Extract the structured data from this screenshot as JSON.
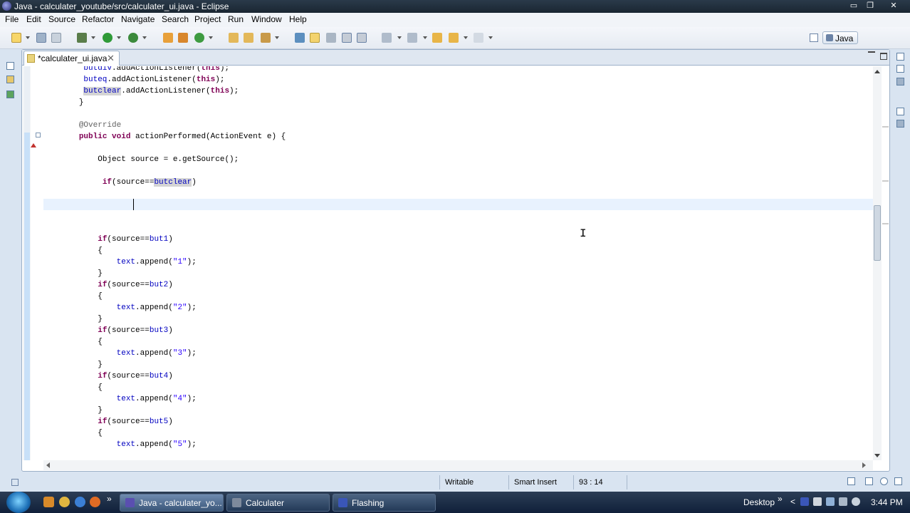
{
  "window": {
    "title": "Java - calculater_youtube/src/calculater_ui.java - Eclipse",
    "min_glyph": "▭",
    "restore_glyph": "❐",
    "close_glyph": "✕"
  },
  "menu": [
    "File",
    "Edit",
    "Source",
    "Refactor",
    "Navigate",
    "Search",
    "Project",
    "Run",
    "Window",
    "Help"
  ],
  "perspective": {
    "label": "Java"
  },
  "editor": {
    "tab_label": "*calculater_ui.java",
    "tab_close": "✕",
    "code_lines": [
      {
        "indent": "    ",
        "parts": [
          {
            "t": "butdiv",
            "c": "fld"
          },
          {
            "t": ".addActionListener("
          },
          {
            "t": "this",
            "c": "kw"
          },
          {
            "t": ");"
          }
        ]
      },
      {
        "indent": "    ",
        "parts": [
          {
            "t": "buteq",
            "c": "fld"
          },
          {
            "t": ".addActionListener("
          },
          {
            "t": "this",
            "c": "kw"
          },
          {
            "t": ");"
          }
        ]
      },
      {
        "indent": "    ",
        "parts": [
          {
            "t": "butclear",
            "c": "fld occ"
          },
          {
            "t": ".addActionListener("
          },
          {
            "t": "this",
            "c": "kw"
          },
          {
            "t": ");"
          }
        ]
      },
      {
        "indent": "   ",
        "parts": [
          {
            "t": "}"
          }
        ]
      },
      {
        "indent": "",
        "parts": []
      },
      {
        "indent": "   ",
        "parts": [
          {
            "t": "@Override",
            "c": "ann"
          }
        ]
      },
      {
        "indent": "   ",
        "parts": [
          {
            "t": "public",
            "c": "kw"
          },
          {
            "t": " "
          },
          {
            "t": "void",
            "c": "kw"
          },
          {
            "t": " actionPerformed(ActionEvent e) {"
          }
        ]
      },
      {
        "indent": "",
        "parts": []
      },
      {
        "indent": "       ",
        "parts": [
          {
            "t": "Object source = e.getSource();"
          }
        ]
      },
      {
        "indent": "",
        "parts": []
      },
      {
        "indent": "        ",
        "parts": [
          {
            "t": "if",
            "c": "kw"
          },
          {
            "t": "(source=="
          },
          {
            "t": "butclear",
            "c": "fld occ"
          },
          {
            "t": ")"
          }
        ]
      },
      {
        "indent": "",
        "parts": []
      },
      {
        "indent": "",
        "parts": []
      },
      {
        "indent": "",
        "parts": []
      },
      {
        "indent": "",
        "parts": []
      },
      {
        "indent": "       ",
        "parts": [
          {
            "t": "if",
            "c": "kw"
          },
          {
            "t": "(source=="
          },
          {
            "t": "but1",
            "c": "fld"
          },
          {
            "t": ")"
          }
        ]
      },
      {
        "indent": "       ",
        "parts": [
          {
            "t": "{"
          }
        ]
      },
      {
        "indent": "           ",
        "parts": [
          {
            "t": "text",
            "c": "fld"
          },
          {
            "t": ".append("
          },
          {
            "t": "\"1\"",
            "c": "str"
          },
          {
            "t": ");"
          }
        ]
      },
      {
        "indent": "       ",
        "parts": [
          {
            "t": "}"
          }
        ]
      },
      {
        "indent": "       ",
        "parts": [
          {
            "t": "if",
            "c": "kw"
          },
          {
            "t": "(source=="
          },
          {
            "t": "but2",
            "c": "fld"
          },
          {
            "t": ")"
          }
        ]
      },
      {
        "indent": "       ",
        "parts": [
          {
            "t": "{"
          }
        ]
      },
      {
        "indent": "           ",
        "parts": [
          {
            "t": "text",
            "c": "fld"
          },
          {
            "t": ".append("
          },
          {
            "t": "\"2\"",
            "c": "str"
          },
          {
            "t": ");"
          }
        ]
      },
      {
        "indent": "       ",
        "parts": [
          {
            "t": "}"
          }
        ]
      },
      {
        "indent": "       ",
        "parts": [
          {
            "t": "if",
            "c": "kw"
          },
          {
            "t": "(source=="
          },
          {
            "t": "but3",
            "c": "fld"
          },
          {
            "t": ")"
          }
        ]
      },
      {
        "indent": "       ",
        "parts": [
          {
            "t": "{"
          }
        ]
      },
      {
        "indent": "           ",
        "parts": [
          {
            "t": "text",
            "c": "fld"
          },
          {
            "t": ".append("
          },
          {
            "t": "\"3\"",
            "c": "str"
          },
          {
            "t": ");"
          }
        ]
      },
      {
        "indent": "       ",
        "parts": [
          {
            "t": "}"
          }
        ]
      },
      {
        "indent": "       ",
        "parts": [
          {
            "t": "if",
            "c": "kw"
          },
          {
            "t": "(source=="
          },
          {
            "t": "but4",
            "c": "fld"
          },
          {
            "t": ")"
          }
        ]
      },
      {
        "indent": "       ",
        "parts": [
          {
            "t": "{"
          }
        ]
      },
      {
        "indent": "           ",
        "parts": [
          {
            "t": "text",
            "c": "fld"
          },
          {
            "t": ".append("
          },
          {
            "t": "\"4\"",
            "c": "str"
          },
          {
            "t": ");"
          }
        ]
      },
      {
        "indent": "       ",
        "parts": [
          {
            "t": "}"
          }
        ]
      },
      {
        "indent": "       ",
        "parts": [
          {
            "t": "if",
            "c": "kw"
          },
          {
            "t": "(source=="
          },
          {
            "t": "but5",
            "c": "fld"
          },
          {
            "t": ")"
          }
        ]
      },
      {
        "indent": "       ",
        "parts": [
          {
            "t": "{"
          }
        ]
      },
      {
        "indent": "           ",
        "parts": [
          {
            "t": "text",
            "c": "fld"
          },
          {
            "t": ".append("
          },
          {
            "t": "\"5\"",
            "c": "str"
          },
          {
            "t": ");"
          }
        ]
      }
    ],
    "ibeam_glyph": "I"
  },
  "status": {
    "writable": "Writable",
    "insert_mode": "Smart Insert",
    "position": "93 : 14"
  },
  "taskbar": {
    "quick_launch_more": "»",
    "tasks": [
      {
        "label": "Java - calculater_yo...",
        "icon_color": "#5a4fb0"
      },
      {
        "label": "Calculater",
        "icon_color": "#7e8a9c"
      },
      {
        "label": "Flashing",
        "icon_color": "#3a56b8"
      }
    ],
    "desktop_label": "Desktop",
    "tray_more": "»",
    "tray_chevron": "<",
    "clock": "3:44 PM"
  },
  "colors": {
    "keyword": "#7f0055",
    "field": "#0000c0",
    "string": "#2a00ff",
    "annotation": "#646464",
    "current_line": "#e8f2fe"
  }
}
